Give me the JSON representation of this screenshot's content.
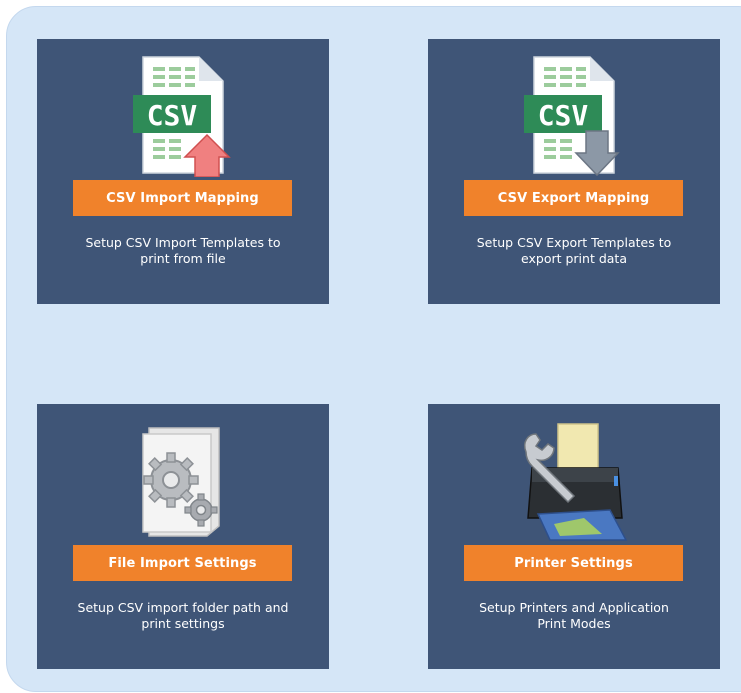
{
  "tiles": [
    {
      "id": "csv-import",
      "button_label": "CSV Import Mapping",
      "description": "Setup CSV Import Templates to print from file",
      "icon": "csv-import-icon",
      "icon_badge": "CSV"
    },
    {
      "id": "csv-export",
      "button_label": "CSV Export Mapping",
      "description": "Setup CSV Export Templates to export print data",
      "icon": "csv-export-icon",
      "icon_badge": "CSV"
    },
    {
      "id": "file-import",
      "button_label": "File Import Settings",
      "description": "Setup CSV import folder path and print settings",
      "icon": "gears-document-icon"
    },
    {
      "id": "printer-settings",
      "button_label": "Printer Settings",
      "description": "Setup Printers and Application Print Modes",
      "icon": "printer-wrench-icon"
    }
  ],
  "colors": {
    "panel_bg": "#d5e6f7",
    "tile_bg": "#3f5577",
    "button_bg": "#f0822b",
    "csv_badge": "#2e8b57"
  }
}
